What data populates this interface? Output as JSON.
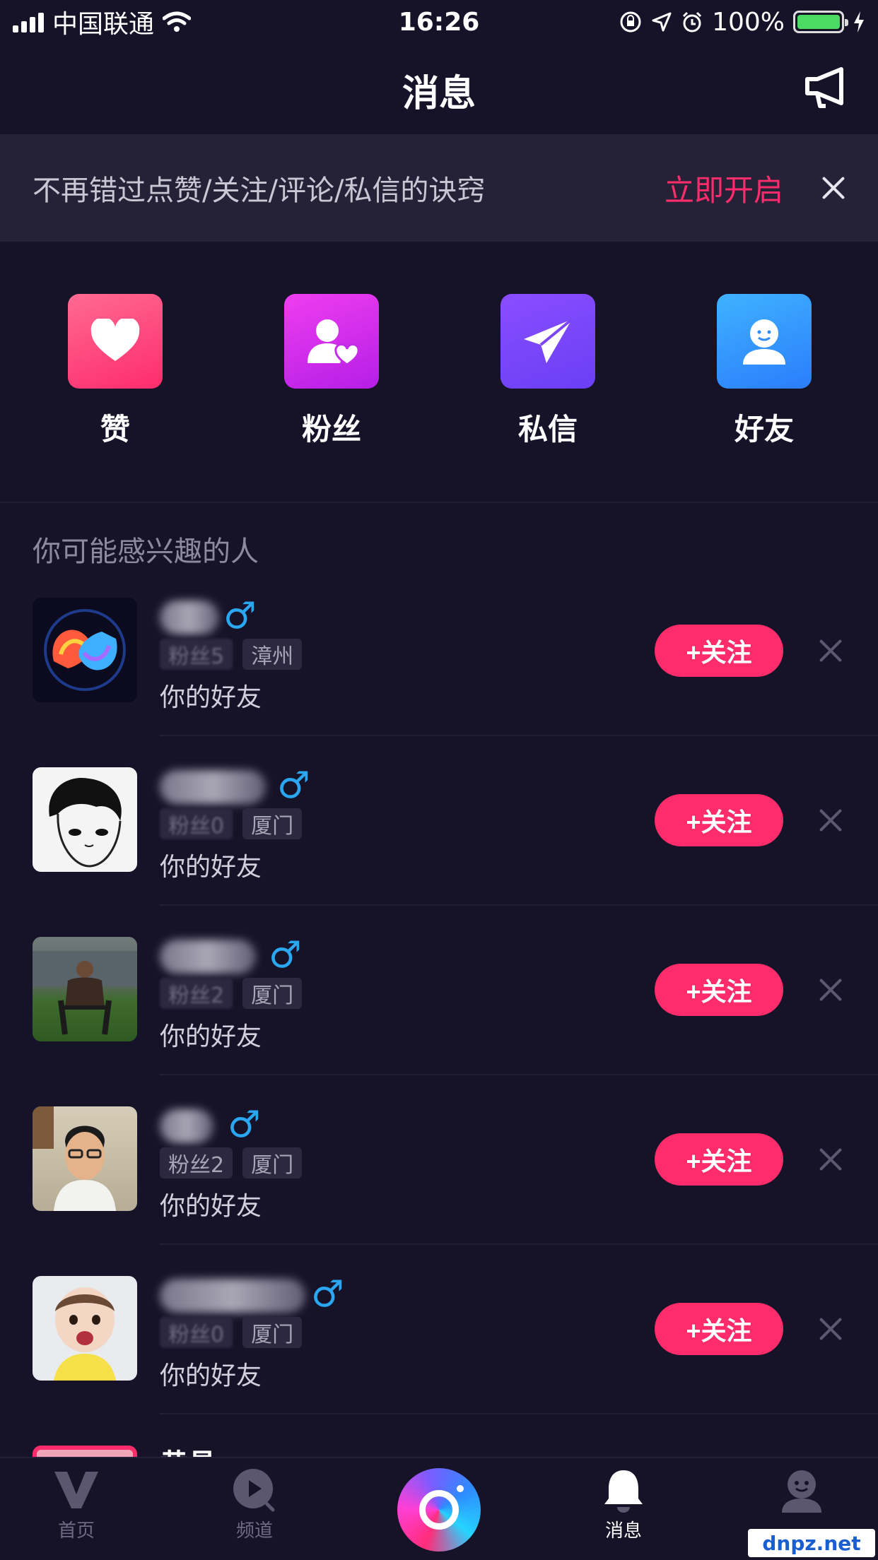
{
  "status_bar": {
    "carrier": "中国联通",
    "time": "16:26",
    "battery": "100%"
  },
  "nav": {
    "title": "消息",
    "announce_icon": "megaphone-icon"
  },
  "banner": {
    "text": "不再错过点赞/关注/评论/私信的诀窍",
    "action": "立即开启"
  },
  "categories": [
    {
      "label": "赞",
      "icon": "heart-icon",
      "color_top": "#ff5c8a",
      "color_bottom": "#fe2c6b"
    },
    {
      "label": "粉丝",
      "icon": "fans-icon",
      "color_top": "#ef3ef0",
      "color_bottom": "#b51ee6"
    },
    {
      "label": "私信",
      "icon": "paper-plane-icon",
      "color_top": "#8a4dff",
      "color_bottom": "#6a3ff5"
    },
    {
      "label": "好友",
      "icon": "friend-icon",
      "color_top": "#3fb2ff",
      "color_bottom": "#2b7dfb"
    }
  ],
  "section_title": "你可能感兴趣的人",
  "suggestions": [
    {
      "fans": "粉丝5",
      "city": "漳州",
      "reason": "你的好友",
      "follow": "+关注"
    },
    {
      "fans": "粉丝0",
      "city": "厦门",
      "reason": "你的好友",
      "follow": "+关注"
    },
    {
      "fans": "粉丝2",
      "city": "厦门",
      "reason": "你的好友",
      "follow": "+关注"
    },
    {
      "fans": "粉丝2",
      "city": "厦门",
      "reason": "你的好友",
      "follow": "+关注"
    },
    {
      "fans": "粉丝0",
      "city": "厦门",
      "reason": "你的好友",
      "follow": "+关注"
    }
  ],
  "partial_name": "黄昌",
  "tabbar": {
    "tabs": [
      {
        "label": "首页",
        "icon": "home-v-icon"
      },
      {
        "label": "频道",
        "icon": "channel-play-icon"
      },
      {
        "label": "消息",
        "icon": "bell-icon"
      },
      {
        "label": "",
        "icon": "profile-icon"
      }
    ]
  },
  "watermark": "dnpz.net",
  "colors": {
    "background": "#161329",
    "accent": "#fe2c6b",
    "male": "#2aa7f0"
  }
}
